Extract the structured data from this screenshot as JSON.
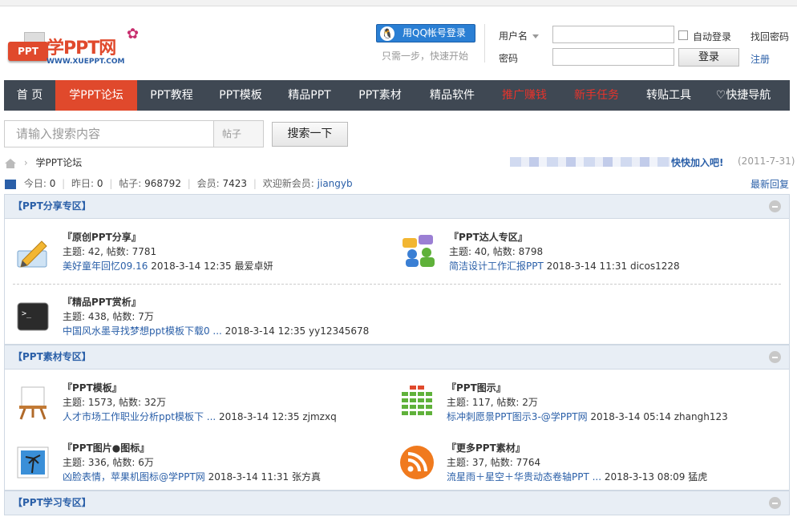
{
  "header": {
    "logo_box": "PPT",
    "logo_text": "学PPT网",
    "logo_url": "WWW.XUEPPT.COM",
    "qq_login": "用QQ帐号登录",
    "qq_sub": "只需一步，快速开始",
    "username_label": "用户名",
    "password_label": "密码",
    "auto_login": "自动登录",
    "forgot": "找回密码",
    "login_btn": "登录",
    "register": "注册"
  },
  "nav": {
    "items": [
      "首 页",
      "学PPT论坛",
      "PPT教程",
      "PPT模板",
      "精品PPT",
      "PPT素材",
      "精品软件",
      "推广赚钱",
      "新手任务",
      "转贴工具",
      "快捷导航"
    ]
  },
  "search": {
    "placeholder": "请输入搜索内容",
    "type": "帖子",
    "button": "搜索一下"
  },
  "breadcrumb": {
    "current": "学PPT论坛"
  },
  "notice": {
    "text": "快快加入吧!",
    "date": "(2011-7-31)"
  },
  "stats": {
    "today_label": "今日:",
    "today": "0",
    "yesterday_label": "昨日:",
    "yesterday": "0",
    "posts_label": "帖子:",
    "posts": "968792",
    "members_label": "会员:",
    "members": "7423",
    "welcome_label": "欢迎新会员:",
    "new_member": "jiangyb",
    "latest_reply": "最新回复"
  },
  "sections": [
    {
      "title": "【PPT分享专区】",
      "forums": [
        {
          "name": "『原创PPT分享』",
          "stats": "主题: 42, 帖数: 7781",
          "last_title": "美好童年回忆09.16",
          "last_time": "2018-3-14 12:35",
          "last_user": "最爱卓妍"
        },
        {
          "name": "『PPT达人专区』",
          "stats": "主题: 40, 帖数: 8798",
          "last_title": "简洁设计工作汇报PPT",
          "last_time": "2018-3-14 11:31",
          "last_user": "dicos1228"
        },
        {
          "name": "『精品PPT赏析』",
          "stats": "主题: 438, 帖数: 7万",
          "last_title": "中国风水墨寻找梦想ppt模板下载0 ...",
          "last_time": "2018-3-14 12:35",
          "last_user": "yy12345678"
        }
      ]
    },
    {
      "title": "【PPT素材专区】",
      "forums": [
        {
          "name": "『PPT模板』",
          "stats": "主题: 1573, 帖数: 32万",
          "last_title": "人才市场工作职业分析ppt模板下 ...",
          "last_time": "2018-3-14 12:35",
          "last_user": "zjmzxq"
        },
        {
          "name": "『PPT图示』",
          "stats": "主题: 117, 帖数: 2万",
          "last_title": "标冲刺愿景PPT图示3-@学PPT网",
          "last_time": "2018-3-14 05:14",
          "last_user": "zhangh123"
        },
        {
          "name": "『PPT图片●图标』",
          "stats": "主题: 336, 帖数: 6万",
          "last_title": "凶脸表情，苹果机图标@学PPT网",
          "last_time": "2018-3-14 11:31",
          "last_user": "张方真"
        },
        {
          "name": "『更多PPT素材』",
          "stats": "主题: 37, 帖数: 7764",
          "last_title": "流星雨＋星空＋华贵动态卷轴PPT ...",
          "last_time": "2018-3-13 08:09",
          "last_user": "猛虎"
        }
      ]
    },
    {
      "title": "【PPT学习专区】"
    }
  ],
  "colors": {
    "accent": "#e0492c",
    "nav_bg": "#3f4853",
    "link": "#2a5fa8",
    "section_bg": "#e8eef5"
  }
}
